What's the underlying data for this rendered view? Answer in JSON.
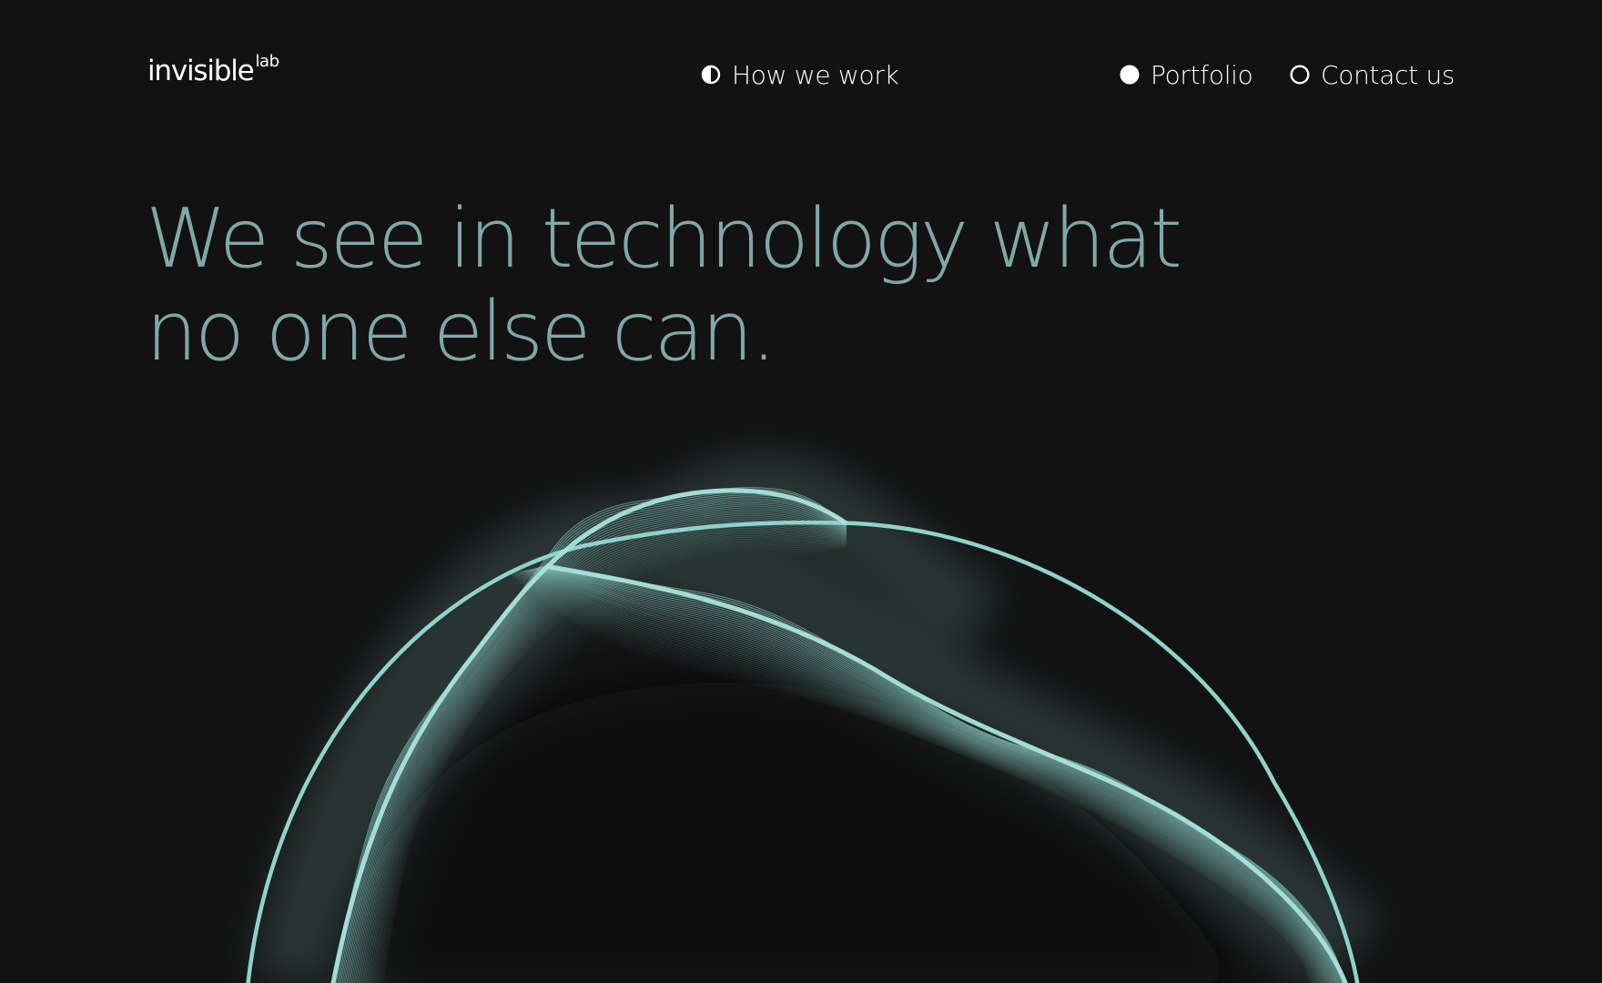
{
  "logo": {
    "main": "invisible",
    "superscript": "lab"
  },
  "nav": {
    "how_we_work": {
      "label": "How we work",
      "icon": "half-circle-icon"
    },
    "portfolio": {
      "label": "Portfolio",
      "icon": "filled-circle-icon"
    },
    "contact": {
      "label": "Contact us",
      "icon": "outline-circle-icon"
    }
  },
  "hero": {
    "line1": "We see in technology what",
    "line2": "no one else can."
  },
  "colors": {
    "background": "#121212",
    "headline": "#7fa8a6",
    "wave": "#8fd3cb",
    "nav_text": "#ffffff"
  }
}
